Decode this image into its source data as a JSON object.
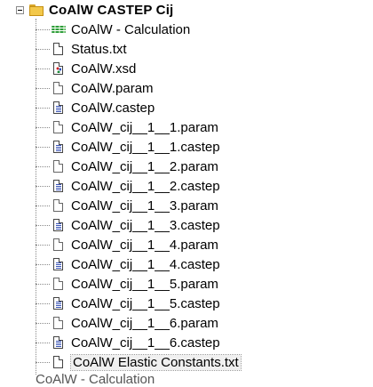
{
  "root": {
    "label": "CoAlW CASTEP Cij"
  },
  "items": [
    {
      "icon": "wave-icon",
      "label": "CoAlW - Calculation"
    },
    {
      "icon": "text-file-icon",
      "label": "Status.txt"
    },
    {
      "icon": "xsd-file-icon",
      "label": "CoAlW.xsd"
    },
    {
      "icon": "param-file-icon",
      "label": "CoAlW.param"
    },
    {
      "icon": "castep-file-icon",
      "label": "CoAlW.castep"
    },
    {
      "icon": "param-file-icon",
      "label": "CoAlW_cij__1__1.param"
    },
    {
      "icon": "castep-file-icon",
      "label": "CoAlW_cij__1__1.castep"
    },
    {
      "icon": "param-file-icon",
      "label": "CoAlW_cij__1__2.param"
    },
    {
      "icon": "castep-file-icon",
      "label": "CoAlW_cij__1__2.castep"
    },
    {
      "icon": "param-file-icon",
      "label": "CoAlW_cij__1__3.param"
    },
    {
      "icon": "castep-file-icon",
      "label": "CoAlW_cij__1__3.castep"
    },
    {
      "icon": "param-file-icon",
      "label": "CoAlW_cij__1__4.param"
    },
    {
      "icon": "castep-file-icon",
      "label": "CoAlW_cij__1__4.castep"
    },
    {
      "icon": "param-file-icon",
      "label": "CoAlW_cij__1__5.param"
    },
    {
      "icon": "castep-file-icon",
      "label": "CoAlW_cij__1__5.castep"
    },
    {
      "icon": "param-file-icon",
      "label": "CoAlW_cij__1__6.param"
    },
    {
      "icon": "castep-file-icon",
      "label": "CoAlW_cij__1__6.castep"
    },
    {
      "icon": "text-file-icon",
      "label": "CoAlW Elastic Constants.txt"
    }
  ],
  "partial_next": "CoAlW - Calculation"
}
